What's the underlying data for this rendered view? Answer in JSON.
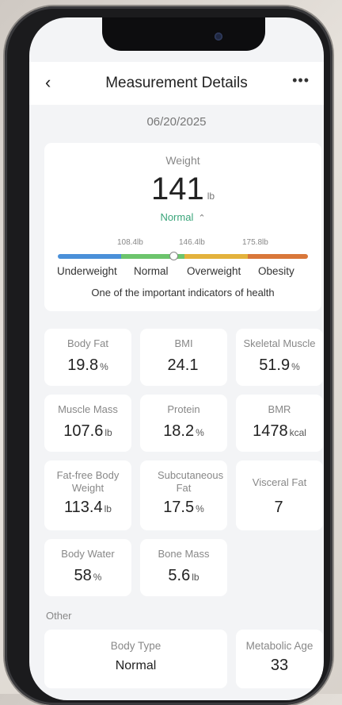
{
  "header": {
    "title": "Measurement Details",
    "back_icon": "chevron-left-icon",
    "more_icon": "more-icon"
  },
  "date": "06/20/2025",
  "weight": {
    "label": "Weight",
    "value": "141",
    "unit": "lb",
    "status": "Normal",
    "thresholds": [
      "108.4lb",
      "146.4lb",
      "175.8lb"
    ],
    "ranges": [
      "Underweight",
      "Normal",
      "Overweight",
      "Obesity"
    ],
    "note": "One of the important indicators of health",
    "colors": {
      "underweight": "#4a90d9",
      "normal": "#6cc46c",
      "overweight": "#e3b23c",
      "obesity": "#d9773a"
    }
  },
  "metrics": [
    {
      "label": "Body Fat",
      "value": "19.8",
      "unit": "%"
    },
    {
      "label": "BMI",
      "value": "24.1",
      "unit": ""
    },
    {
      "label": "Skeletal Muscle",
      "value": "51.9",
      "unit": "%"
    },
    {
      "label": "Muscle Mass",
      "value": "107.6",
      "unit": "lb"
    },
    {
      "label": "Protein",
      "value": "18.2",
      "unit": "%"
    },
    {
      "label": "BMR",
      "value": "1478",
      "unit": "kcal"
    },
    {
      "label": "Fat-free Body Weight",
      "value": "113.4",
      "unit": "lb"
    },
    {
      "label": "Subcutaneous Fat",
      "value": "17.5",
      "unit": "%"
    },
    {
      "label": "Visceral Fat",
      "value": "7",
      "unit": ""
    },
    {
      "label": "Body Water",
      "value": "58",
      "unit": "%"
    },
    {
      "label": "Bone Mass",
      "value": "5.6",
      "unit": "lb"
    }
  ],
  "other": {
    "section_label": "Other",
    "body_type": {
      "label": "Body Type",
      "value": "Normal"
    },
    "metabolic_age": {
      "label": "Metabolic Age",
      "value": "33"
    }
  }
}
